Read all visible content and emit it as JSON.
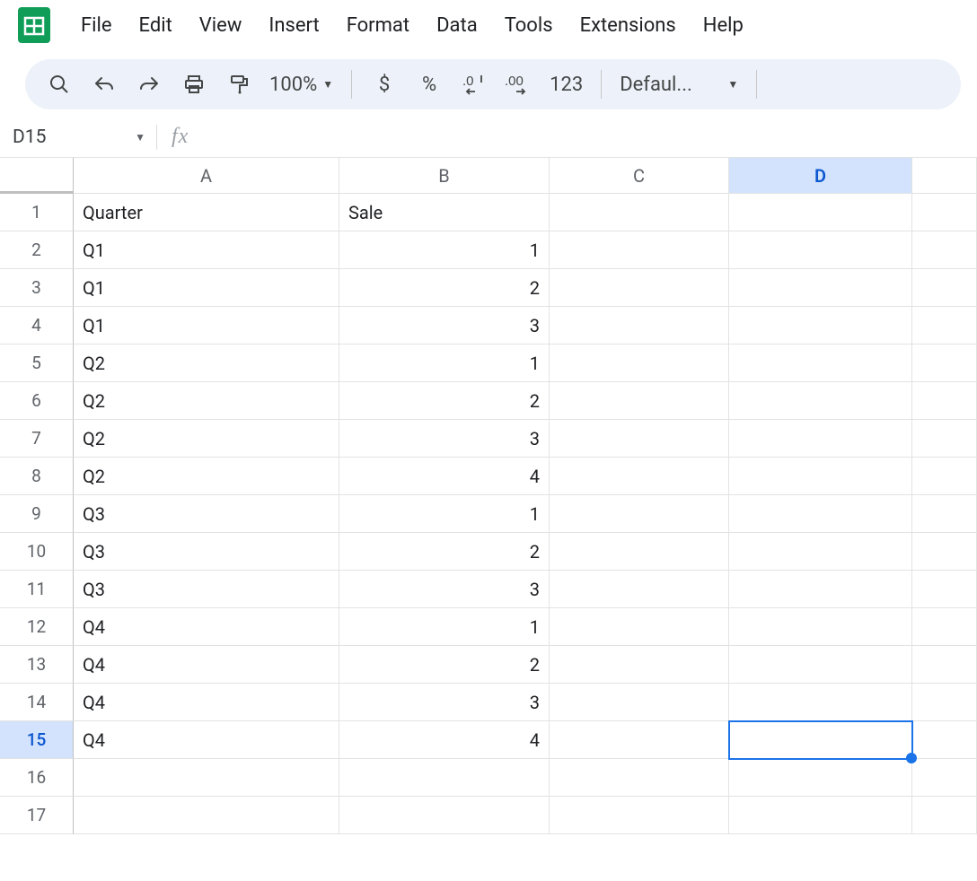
{
  "menus": {
    "file": "File",
    "edit": "Edit",
    "view": "View",
    "insert": "Insert",
    "format": "Format",
    "data": "Data",
    "tools": "Tools",
    "extensions": "Extensions",
    "help": "Help"
  },
  "toolbar": {
    "zoom": "100%",
    "currency": "$",
    "percent": "%",
    "dec_decrease": ".0",
    "dec_increase": ".00",
    "more_formats": "123",
    "font": "Defaul..."
  },
  "namebox": {
    "ref": "D15",
    "fx": "fx",
    "formula": ""
  },
  "columns": [
    "A",
    "B",
    "C",
    "D",
    ""
  ],
  "selected_col_index": 3,
  "selected_row": 15,
  "rows": [
    {
      "n": 1,
      "a": "Quarter",
      "b": "Sale"
    },
    {
      "n": 2,
      "a": "Q1",
      "b": "1"
    },
    {
      "n": 3,
      "a": "Q1",
      "b": "2"
    },
    {
      "n": 4,
      "a": "Q1",
      "b": "3"
    },
    {
      "n": 5,
      "a": "Q2",
      "b": "1"
    },
    {
      "n": 6,
      "a": "Q2",
      "b": "2"
    },
    {
      "n": 7,
      "a": "Q2",
      "b": "3"
    },
    {
      "n": 8,
      "a": "Q2",
      "b": "4"
    },
    {
      "n": 9,
      "a": "Q3",
      "b": "1"
    },
    {
      "n": 10,
      "a": "Q3",
      "b": "2"
    },
    {
      "n": 11,
      "a": "Q3",
      "b": "3"
    },
    {
      "n": 12,
      "a": "Q4",
      "b": "1"
    },
    {
      "n": 13,
      "a": "Q4",
      "b": "2"
    },
    {
      "n": 14,
      "a": "Q4",
      "b": "3"
    },
    {
      "n": 15,
      "a": "Q4",
      "b": "4"
    },
    {
      "n": 16,
      "a": "",
      "b": ""
    },
    {
      "n": 17,
      "a": "",
      "b": ""
    }
  ],
  "chart_data": {
    "type": "table",
    "columns": [
      "Quarter",
      "Sale"
    ],
    "rows": [
      [
        "Q1",
        1
      ],
      [
        "Q1",
        2
      ],
      [
        "Q1",
        3
      ],
      [
        "Q2",
        1
      ],
      [
        "Q2",
        2
      ],
      [
        "Q2",
        3
      ],
      [
        "Q2",
        4
      ],
      [
        "Q3",
        1
      ],
      [
        "Q3",
        2
      ],
      [
        "Q3",
        3
      ],
      [
        "Q4",
        1
      ],
      [
        "Q4",
        2
      ],
      [
        "Q4",
        3
      ],
      [
        "Q4",
        4
      ]
    ]
  }
}
